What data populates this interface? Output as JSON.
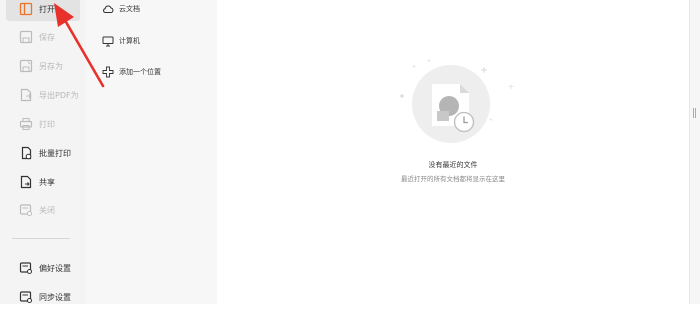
{
  "menu": {
    "open": "打开",
    "save": "保存",
    "save_as": "另存为",
    "export_pdf": "导出PDF为",
    "print": "打印",
    "batch_print": "批量打印",
    "share": "共享",
    "close": "关闭",
    "preferences": "偏好设置",
    "sync_settings": "同步设置"
  },
  "locations": {
    "cloud_docs": "云文档",
    "computer": "计算机",
    "add_location": "添加一个位置"
  },
  "empty_state": {
    "title": "没有最近的文件",
    "subtitle": "最近打开的所有文档都将显示在这里"
  },
  "colors": {
    "annotation_arrow": "#e8312a",
    "menu_bg": "#f4f4f4",
    "locations_bg": "#f7f7f7",
    "illustration_circle": "#eeeeee",
    "disabled_text": "#b8b8b8"
  }
}
